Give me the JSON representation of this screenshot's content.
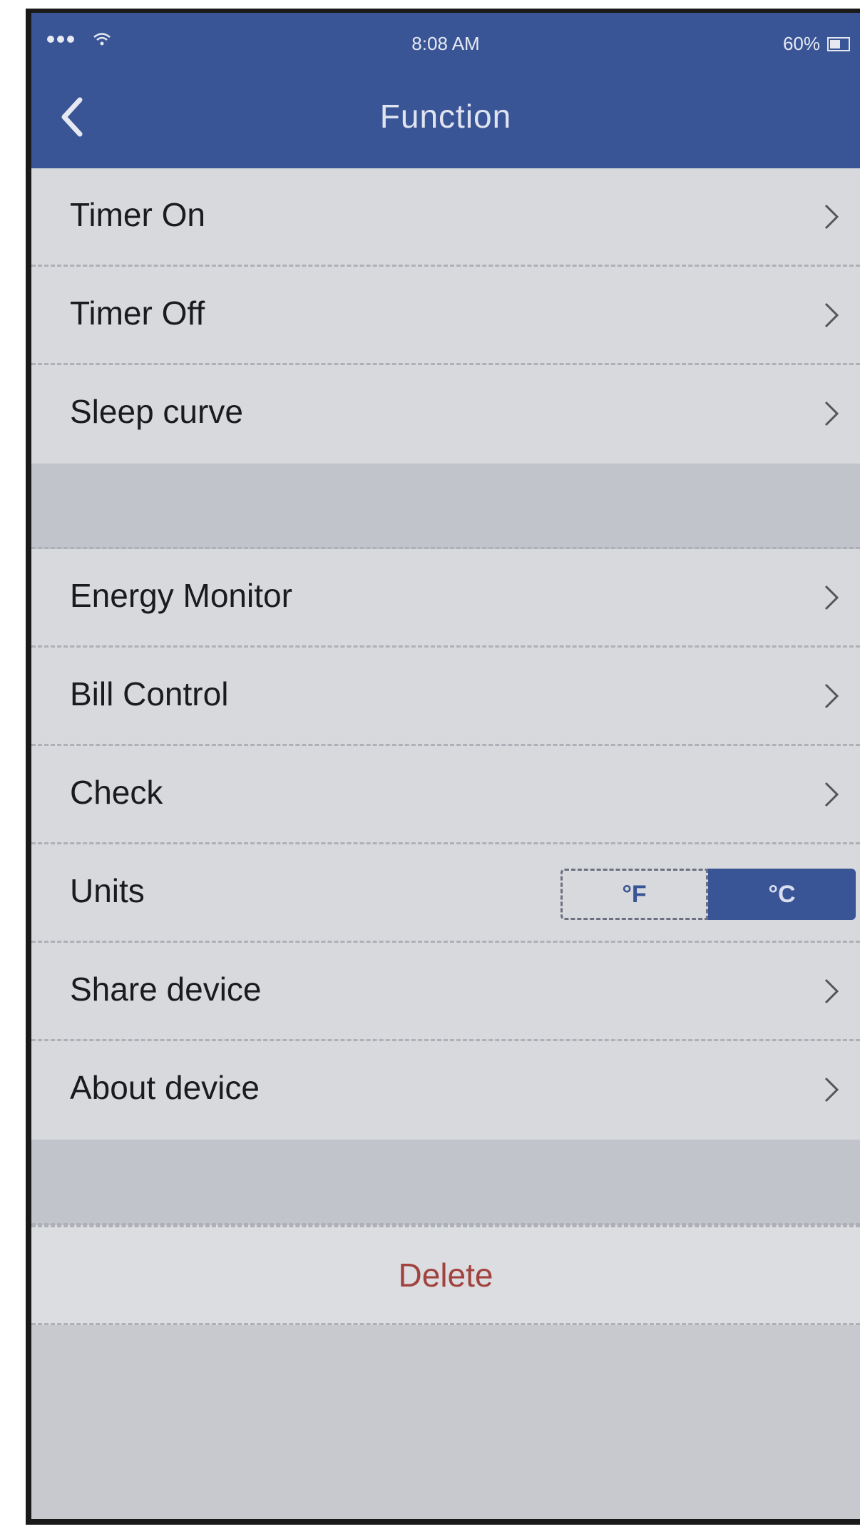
{
  "status_bar": {
    "time": "8:08 AM",
    "battery": "60%"
  },
  "nav": {
    "title": "Function"
  },
  "groups": [
    {
      "items": [
        {
          "label": "Timer On"
        },
        {
          "label": "Timer Off"
        },
        {
          "label": "Sleep curve"
        }
      ]
    },
    {
      "items": [
        {
          "label": "Energy Monitor"
        },
        {
          "label": "Bill Control"
        },
        {
          "label": "Check"
        },
        {
          "label": "Units",
          "toggle": {
            "options": [
              "°F",
              "°C"
            ],
            "selected": "°C"
          }
        },
        {
          "label": "Share device"
        },
        {
          "label": "About device"
        }
      ]
    }
  ],
  "delete": {
    "label": "Delete"
  },
  "colors": {
    "accent": "#3a5596",
    "destructive": "#a2423e",
    "background": "#c7c9cf"
  },
  "icons": {
    "back": "chevron-left-icon",
    "row": "chevron-right-icon",
    "wifi": "wifi-icon",
    "battery": "battery-icon"
  }
}
